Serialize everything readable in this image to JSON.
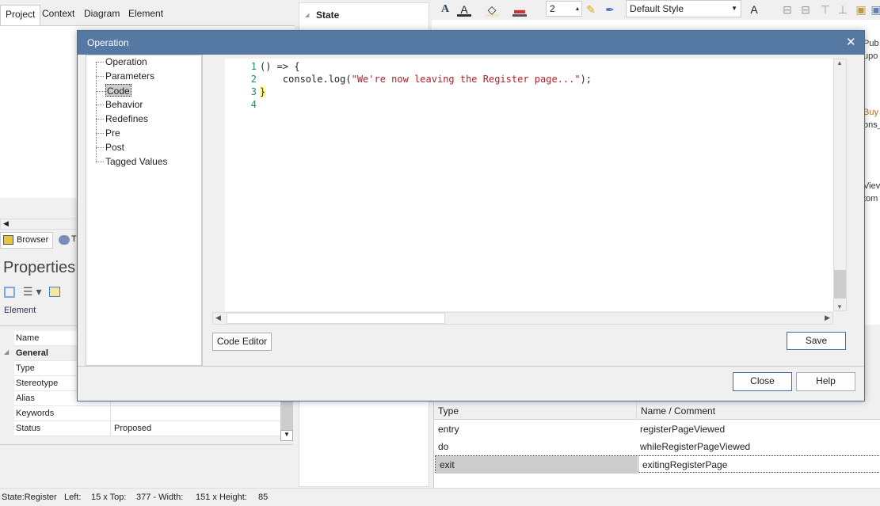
{
  "left_panel": {
    "tabs": [
      "Project",
      "Context",
      "Diagram",
      "Element"
    ],
    "active_tab": "Project",
    "bottom_tabs": [
      "Browser",
      "T"
    ],
    "properties": {
      "title": "Properties",
      "section_tab": "Element",
      "rows": [
        {
          "name": "Name",
          "value": ""
        },
        {
          "name": "General",
          "value": "",
          "group": true
        },
        {
          "name": "Type",
          "value": ""
        },
        {
          "name": "Stereotype",
          "value": ""
        },
        {
          "name": "Alias",
          "value": ""
        },
        {
          "name": "Keywords",
          "value": ""
        },
        {
          "name": "Status",
          "value": "Proposed"
        }
      ]
    }
  },
  "middle_panel": {
    "header": "State"
  },
  "toolbar": {
    "line_width": "2",
    "style_select": "Default Style"
  },
  "diagram_fragments": [
    "Pub",
    "upo",
    "Buy :",
    "ons_",
    "Viev",
    "tom"
  ],
  "behavior_table": {
    "headers": [
      "Type",
      "Name / Comment"
    ],
    "rows": [
      {
        "type": "entry",
        "name": "registerPageViewed"
      },
      {
        "type": "do",
        "name": "whileRegisterPageViewed"
      },
      {
        "type": "exit",
        "name": "exitingRegisterPage",
        "selected": true
      }
    ]
  },
  "status_bar": {
    "element": "State:Register",
    "left_label": "Left:",
    "left": "15 x Top:",
    "top": "377 - Width:",
    "width": "151 x Height:",
    "height": "85"
  },
  "dialog": {
    "title": "Operation",
    "nav": [
      "Operation",
      "Parameters",
      "Code",
      "Behavior",
      "Redefines",
      "Pre",
      "Post",
      "Tagged Values"
    ],
    "selected_nav": "Code",
    "code_lines": [
      {
        "n": "1",
        "text": "() => {"
      },
      {
        "n": "2",
        "pre": "    console.log(",
        "str": "\"We're now leaving the Register page...\"",
        "post": ");"
      },
      {
        "n": "3",
        "text": "}"
      },
      {
        "n": "4",
        "text": ""
      }
    ],
    "code_editor_button": "Code Editor",
    "save_button": "Save",
    "close_button": "Close",
    "help_button": "Help"
  },
  "colors": {
    "titlebar": "#5579a2",
    "selection": "#cccccc",
    "string": "#b0202a",
    "line_number": "#1a8a7a"
  }
}
